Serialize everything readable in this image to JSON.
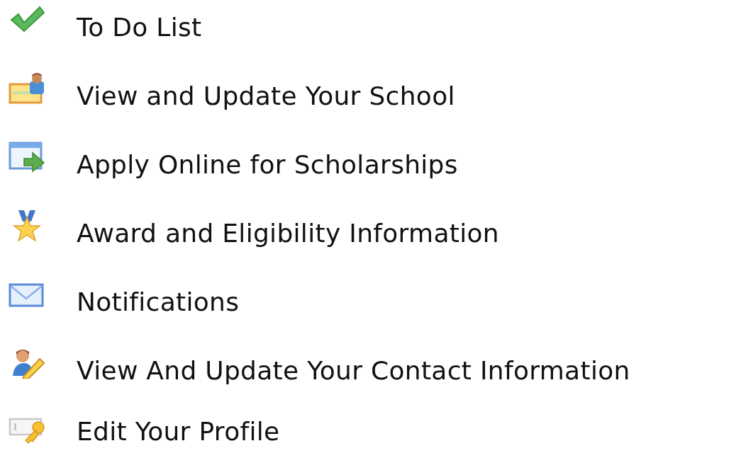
{
  "menu": {
    "items": [
      {
        "kind": "check",
        "label": "To Do List"
      },
      {
        "kind": "school",
        "label": "View and Update Your School"
      },
      {
        "kind": "apply",
        "label": "Apply Online for Scholarships"
      },
      {
        "kind": "award",
        "label": "Award and Eligibility Information"
      },
      {
        "kind": "mail",
        "label": "Notifications"
      },
      {
        "kind": "contact",
        "label": "View And Update Your Contact Information"
      },
      {
        "kind": "profile",
        "label": "Edit Your Profile"
      }
    ]
  }
}
